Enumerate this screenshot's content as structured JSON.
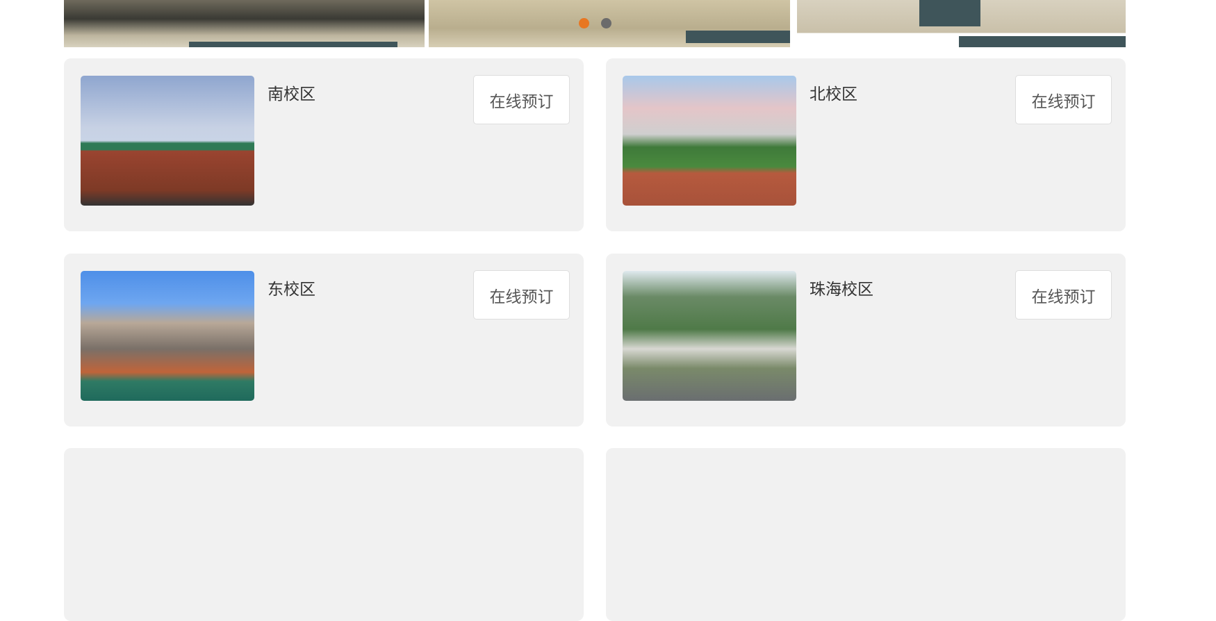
{
  "carousel": {
    "slides": 2,
    "active_index": 0,
    "colors": {
      "active": "#e87722",
      "inactive": "#6b6b6b"
    }
  },
  "campuses": [
    {
      "name": "南校区",
      "button": "在线预订"
    },
    {
      "name": "北校区",
      "button": "在线预订"
    },
    {
      "name": "东校区",
      "button": "在线预订"
    },
    {
      "name": "珠海校区",
      "button": "在线预订"
    }
  ]
}
